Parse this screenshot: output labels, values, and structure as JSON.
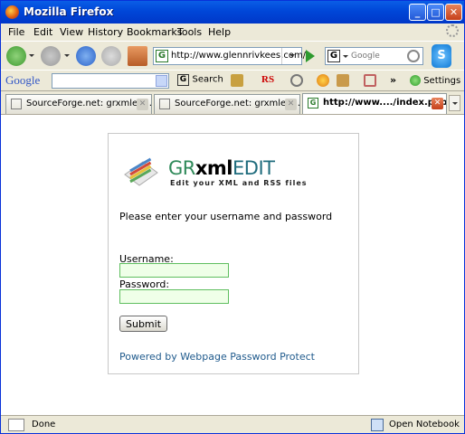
{
  "window": {
    "title": "Mozilla Firefox",
    "minimize": "_",
    "maximize": "□",
    "close": "✕"
  },
  "menu": [
    "File",
    "Edit",
    "View",
    "History",
    "Bookmarks",
    "Tools",
    "Help"
  ],
  "navbar": {
    "url": "http://www.glennrivkees.com/",
    "search_placeholder": "Google",
    "search_engine_icon": "G",
    "url_favicon": "G",
    "skype_icon": "S"
  },
  "googlebar": {
    "logo": "Google",
    "search_icon": "G",
    "search_label": "Search",
    "settings_label": "Settings"
  },
  "tabs": [
    {
      "label": "SourceForge.net: grxmledi…",
      "active": false
    },
    {
      "label": "SourceForge.net: grxmledi…",
      "active": false
    },
    {
      "label": "http://www..../index.php",
      "active": true,
      "favicon": "G"
    }
  ],
  "page": {
    "brand_gr": "GR",
    "brand_xml": "xml",
    "brand_edit": "EDIT",
    "tagline": "Edit your XML and RSS files",
    "prompt": "Please enter your username and password",
    "username_label": "Username:",
    "username_value": "",
    "password_label": "Password:",
    "password_value": "",
    "submit_label": "Submit",
    "powered_by": "Powered by Webpage Password Protect"
  },
  "status": {
    "text": "Done",
    "notebook": "Open Notebook"
  },
  "colors": {
    "title_bar": "#0046d8",
    "brand_gr": "#2f8a5a",
    "brand_edit": "#1f6c7d",
    "link": "#1f5a8c",
    "field_border": "#5fbf5f"
  }
}
